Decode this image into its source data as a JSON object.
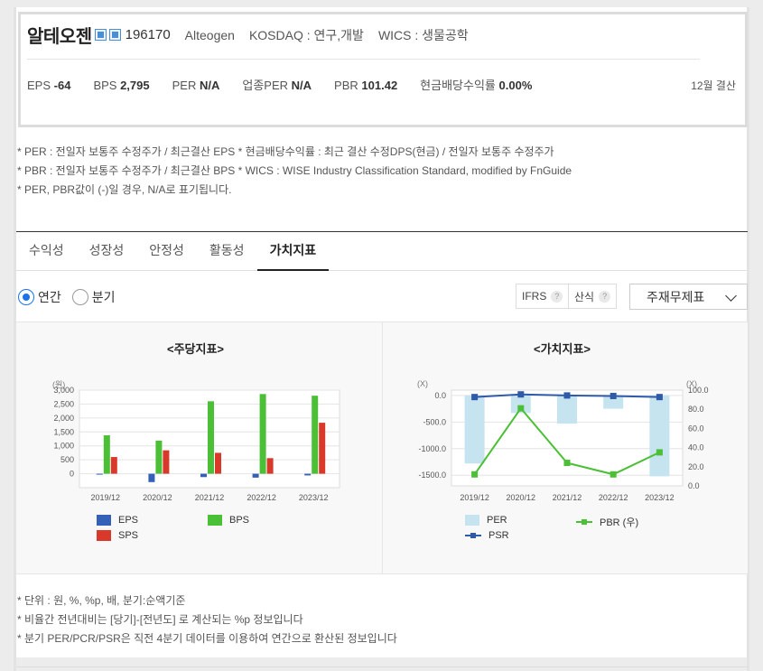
{
  "company": {
    "name": "알테오젠",
    "code": "196170",
    "eng_name": "Alteogen",
    "market": "KOSDAQ : 연구,개발",
    "wics": "WICS : 생물공학",
    "icons": [
      "home-icon",
      "building-icon"
    ]
  },
  "metrics": [
    {
      "label": "EPS",
      "value": "-64"
    },
    {
      "label": "BPS",
      "value": "2,795"
    },
    {
      "label": "PER",
      "value": "N/A"
    },
    {
      "label": "업종PER",
      "value": "N/A"
    },
    {
      "label": "PBR",
      "value": "101.42"
    },
    {
      "label": "현금배당수익률",
      "value": "0.00%"
    }
  ],
  "settlement": "12월 결산",
  "notes": [
    "* PER : 전일자 보통주 수정주가 / 최근결산 EPS * 현금배당수익률 : 최근 결산 수정DPS(현금) / 전일자 보통주 수정주가",
    "* PBR : 전일자 보통주 수정주가 / 최근결산 BPS * WICS : WISE Industry Classification Standard, modified by FnGuide",
    "* PER, PBR값이 (-)일 경우, N/A로 표기됩니다."
  ],
  "tabs": [
    {
      "label": "수익성",
      "active": false
    },
    {
      "label": "성장성",
      "active": false
    },
    {
      "label": "안정성",
      "active": false
    },
    {
      "label": "활동성",
      "active": false
    },
    {
      "label": "가치지표",
      "active": true
    }
  ],
  "period": {
    "options": [
      "연간",
      "분기"
    ],
    "selected": "연간"
  },
  "options": {
    "ifrs": "IFRS",
    "calc": "산식",
    "help": "?"
  },
  "statement_select": "주재무제표",
  "colors": {
    "eps": "#3560b8",
    "bps": "#4bbf35",
    "sps": "#d8392a",
    "per": "#c5e4ef",
    "pbr": "#4bbf35",
    "psr": "#2f5aa8",
    "accent": "#1a73e8"
  },
  "chart_data": [
    {
      "type": "bar",
      "title": "<주당지표>",
      "unit_label": "(원)",
      "categories": [
        "2019/12",
        "2020/12",
        "2021/12",
        "2022/12",
        "2023/12"
      ],
      "ylim": [
        -500,
        3000
      ],
      "yticks": [
        0,
        500,
        1000,
        1500,
        2000,
        2500,
        3000
      ],
      "ytick_labels": [
        "0",
        "500",
        "1,000",
        "1,500",
        "2,000",
        "2,500",
        "3,000"
      ],
      "series": [
        {
          "name": "EPS",
          "values": [
            0,
            -300,
            -120,
            -140,
            -60
          ]
        },
        {
          "name": "BPS",
          "values": [
            1380,
            1190,
            2600,
            2860,
            2800
          ]
        },
        {
          "name": "SPS",
          "values": [
            600,
            840,
            750,
            560,
            1830
          ]
        }
      ],
      "grid": true,
      "legend": "bottom"
    },
    {
      "type": "bar+line",
      "title": "<가치지표>",
      "left_unit": "(X)",
      "right_unit": "(X)",
      "categories": [
        "2019/12",
        "2020/12",
        "2021/12",
        "2022/12",
        "2023/12"
      ],
      "left_ylim": [
        -1700,
        100
      ],
      "left_yticks": [
        0,
        -500,
        -1000,
        -1500
      ],
      "left_ytick_labels": [
        "0.0",
        "-500.0",
        "-1000.0",
        "-1500.0"
      ],
      "right_ylim": [
        0,
        100
      ],
      "right_yticks": [
        0,
        20,
        40,
        60,
        80,
        100
      ],
      "right_ytick_labels": [
        "0.0",
        "20.0",
        "40.0",
        "60.0",
        "80.0",
        "100.0"
      ],
      "series": [
        {
          "name": "PER",
          "axis": "left",
          "kind": "bar",
          "values": [
            -1280,
            -330,
            -530,
            -250,
            -1520
          ]
        },
        {
          "name": "PBR (우)",
          "axis": "right",
          "kind": "line",
          "values": [
            12,
            81,
            24,
            12,
            35
          ]
        },
        {
          "name": "PSR",
          "axis": "left",
          "kind": "line",
          "values": [
            -30,
            20,
            0,
            -10,
            -30
          ]
        }
      ],
      "grid": true,
      "legend": "bottom"
    }
  ],
  "bottom_notes": [
    "* 단위 : 원, %, %p, 배, 분기:순액기준",
    "* 비율간 전년대비는 [당기]-[전년도] 로 계산되는 %p 정보입니다",
    "* 분기 PER/PCR/PSR은 직전 4분기 데이터를 이용하여 연간으로 환산된 정보입니다"
  ]
}
